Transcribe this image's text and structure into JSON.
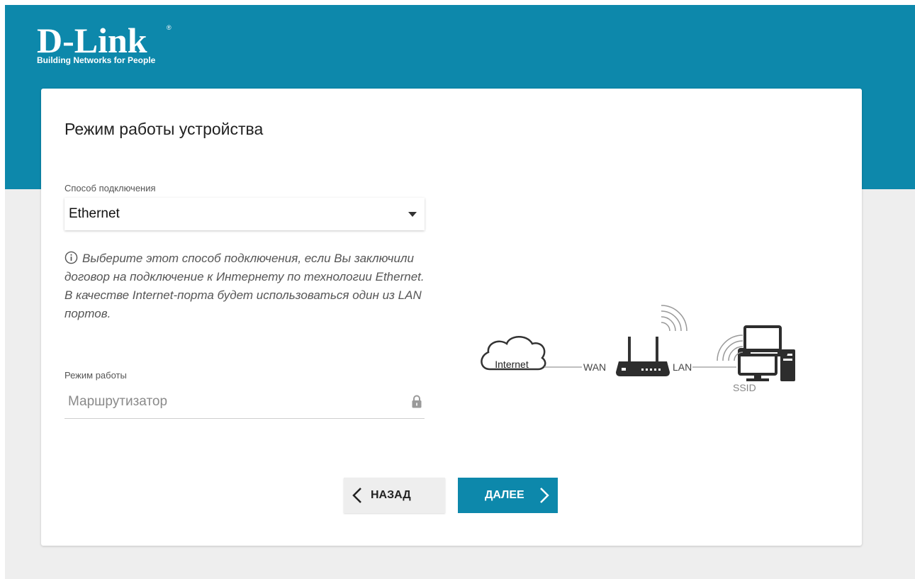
{
  "brand": {
    "name": "D-Link",
    "tagline": "Building Networks for People"
  },
  "page": {
    "title": "Режим работы устройства"
  },
  "connection": {
    "label": "Способ подключения",
    "value": "Ethernet"
  },
  "hint": {
    "text": "Выберите этот способ подключения, если Вы заключили договор на подключение к Интернету по технологии Ethernet. В качестве Internet-порта будет использоваться один из LAN портов."
  },
  "mode": {
    "label": "Режим работы",
    "value": "Маршрутизатор"
  },
  "diagram": {
    "internet": "Internet",
    "wan": "WAN",
    "lan": "LAN",
    "ssid": "SSID"
  },
  "buttons": {
    "back": "НАЗАД",
    "next": "ДАЛЕЕ"
  },
  "colors": {
    "brand": "#0d88ab",
    "background": "#eeeeee",
    "card": "#ffffff"
  },
  "icons": {
    "info": "info-circle-icon",
    "lock": "lock-icon",
    "dropdown": "caret-down-icon",
    "back": "chevron-left-icon",
    "next": "chevron-right-icon"
  }
}
